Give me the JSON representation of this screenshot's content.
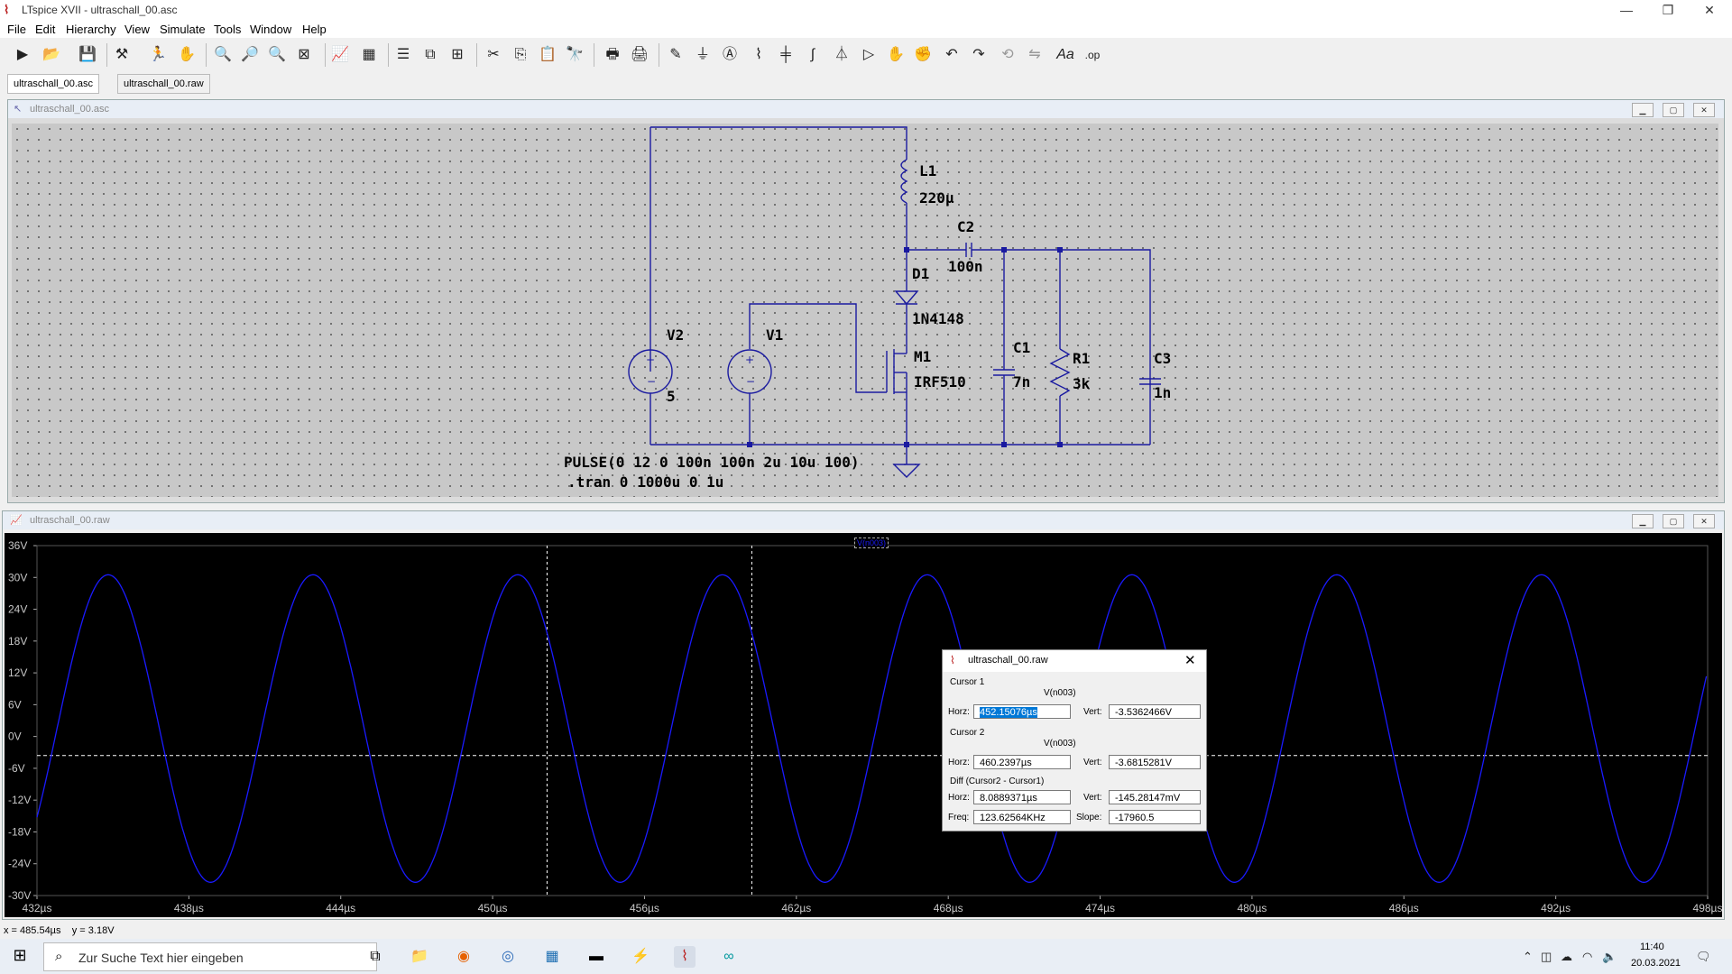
{
  "window": {
    "title": "LTspice XVII - ultraschall_00.asc"
  },
  "menu": [
    "File",
    "Edit",
    "Hierarchy",
    "View",
    "Simulate",
    "Tools",
    "Window",
    "Help"
  ],
  "tabs": [
    {
      "label": "ultraschall_00.asc"
    },
    {
      "label": "ultraschall_00.raw"
    }
  ],
  "schematic_window": {
    "title": "ultraschall_00.asc"
  },
  "waveform_window": {
    "title": "ultraschall_00.raw"
  },
  "schematic": {
    "labels": {
      "L1": "L1",
      "L1_val": "220µ",
      "C2": "C2",
      "C2_val": "100n",
      "D1": "D1",
      "D1_val": "1N4148",
      "V2": "V2",
      "V2_val": "5",
      "V1": "V1",
      "M1": "M1",
      "M1_val": "IRF510",
      "C1": "C1",
      "C1_val": "7n",
      "R1": "R1",
      "R1_val": "3k",
      "C3": "C3",
      "C3_val": "1n",
      "pulse": "PULSE(0 12 0 100n 100n 2u 10u 100)",
      "tran": ".tran 0 1000u 0 1u"
    }
  },
  "plot": {
    "trace_label": "V(n003)",
    "trace_color": "#1a1aff",
    "cursor_color": "#ffffff"
  },
  "chart_data": {
    "type": "line",
    "series": [
      {
        "name": "V(n003)",
        "amplitude": 29,
        "offset": 1.5,
        "frequency_hz": 123626,
        "phase_ref_us": 450.0
      }
    ],
    "x_range": [
      432,
      498
    ],
    "y_range": [
      -30,
      36
    ],
    "xlabel_ticks": [
      "432µs",
      "438µs",
      "444µs",
      "450µs",
      "456µs",
      "462µs",
      "468µs",
      "474µs",
      "480µs",
      "486µs",
      "492µs",
      "498µs"
    ],
    "ylabel_ticks": [
      "36V",
      "30V",
      "24V",
      "18V",
      "12V",
      "6V",
      "0V",
      "-6V",
      "-12V",
      "-18V",
      "-24V",
      "-30V"
    ],
    "cursor1_x": 452.15076,
    "cursor2_x": 460.2397,
    "cursor_y": -3.6
  },
  "dialog": {
    "title": "ultraschall_00.raw",
    "cursor1_label": "Cursor 1",
    "cursor1_sig": "V(n003)",
    "cursor1_horz": "452.15076µs",
    "cursor1_vert": "-3.5362466V",
    "cursor2_label": "Cursor 2",
    "cursor2_sig": "V(n003)",
    "cursor2_horz": "460.2397µs",
    "cursor2_vert": "-3.6815281V",
    "diff_label": "Diff (Cursor2 - Cursor1)",
    "diff_horz": "8.0889371µs",
    "diff_vert": "-145.28147mV",
    "freq": "123.62564KHz",
    "slope": "-17960.5",
    "horz_lbl": "Horz:",
    "vert_lbl": "Vert:",
    "freq_lbl": "Freq:",
    "slope_lbl": "Slope:"
  },
  "status": {
    "coords": "x = 485.54µs    y = 3.18V"
  },
  "taskbar": {
    "search_placeholder": "Zur Suche Text hier eingeben",
    "time": "11:40",
    "date": "20.03.2021"
  }
}
